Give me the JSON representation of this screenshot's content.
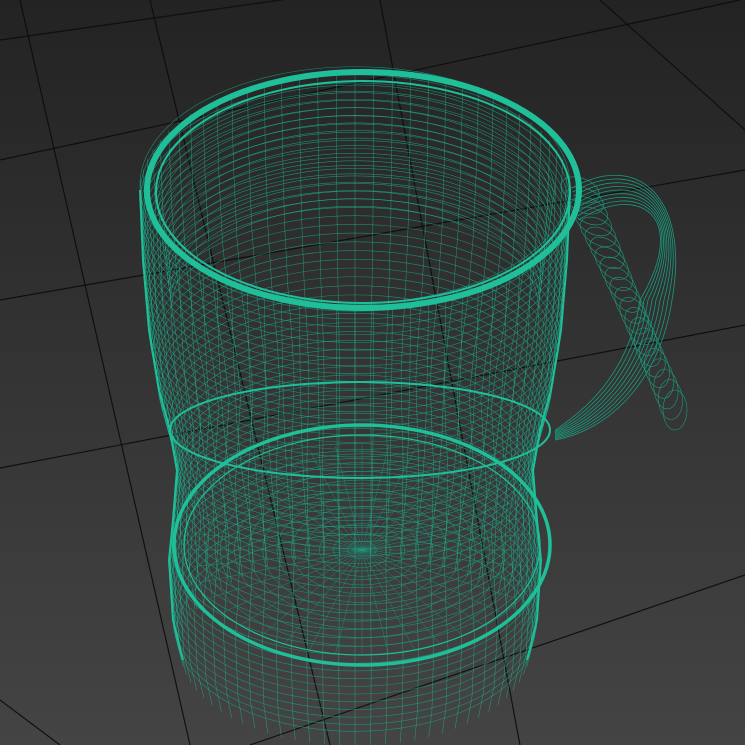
{
  "viewport": {
    "background_top": "#232323",
    "background_bottom": "#444444",
    "grid_color": "#0c0c0c",
    "wire_color": "#1fbf99",
    "wire_color_dim": "#1a9c7e"
  },
  "object": {
    "icon": "mug-wireframe-icon",
    "shading": "wireframe"
  }
}
